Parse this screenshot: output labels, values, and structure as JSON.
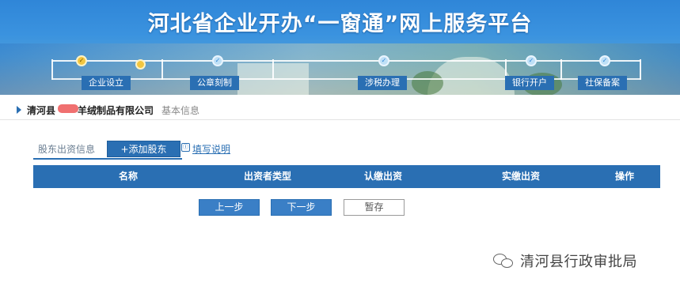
{
  "header": {
    "title": "河北省企业开办“一窗通”网上服务平台"
  },
  "steps": [
    {
      "label": "企业设立",
      "state": "active"
    },
    {
      "label": "公章刻制",
      "state": "pending"
    },
    {
      "label": "涉税办理",
      "state": "pending"
    },
    {
      "label": "银行开户",
      "state": "pending"
    },
    {
      "label": "社保备案",
      "state": "pending"
    }
  ],
  "company": {
    "name_prefix": "清河县",
    "name_suffix": "羊绒制品有限公司",
    "section": "基本信息"
  },
  "shareholder_tab": {
    "label": "股东出资信息",
    "add_button": "+添加股东",
    "guide_link": "填写说明"
  },
  "table": {
    "columns": [
      "名称",
      "出资者类型",
      "认缴出资",
      "实缴出资",
      "操作"
    ],
    "rows": []
  },
  "actions": {
    "prev": "上一步",
    "next": "下一步",
    "save": "暂存"
  },
  "watermark": {
    "text": "清河县行政审批局"
  },
  "colors": {
    "primary": "#2a6fb3",
    "active_step": "#f3c640",
    "pending_step": "#bfe0f6"
  }
}
